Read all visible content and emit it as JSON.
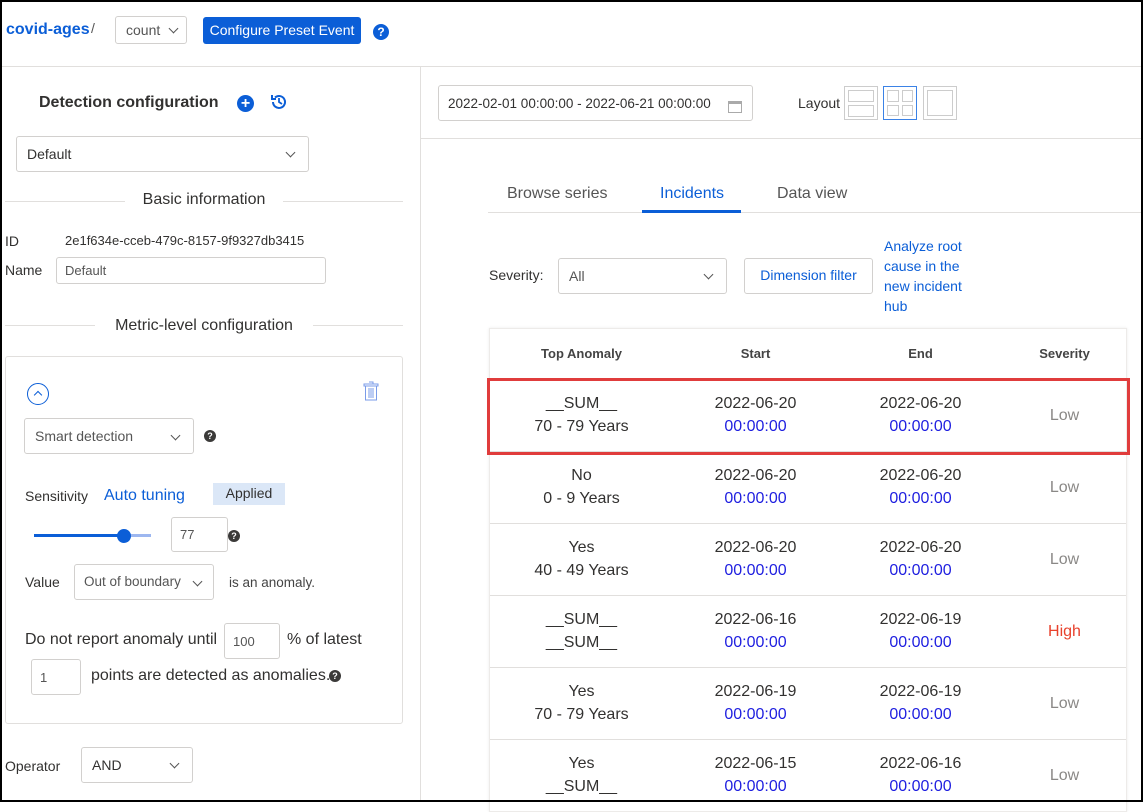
{
  "header": {
    "metric": "covid-ages",
    "separator": "/",
    "measure": "count",
    "configure_btn": "Configure Preset Event"
  },
  "left": {
    "title": "Detection configuration",
    "config_select": "Default",
    "basic_info": "Basic information",
    "id_label": "ID",
    "id_value": "2e1f634e-cceb-479c-8157-9f9327db3415",
    "name_label": "Name",
    "name_value": "Default",
    "metric_level": "Metric-level configuration",
    "method": "Smart detection",
    "sensitivity_label": "Sensitivity",
    "auto_tuning": "Auto tuning",
    "applied": "Applied",
    "sensitivity_value": "77",
    "sensitivity_fraction": 0.77,
    "value_label": "Value",
    "value_select": "Out of boundary",
    "anomaly_text": "is an anomaly.",
    "report_text1": "Do not report anomaly until",
    "report_pct": "100",
    "report_text2": "% of latest",
    "report_points": "1",
    "report_text3": "points are detected as anomalies.",
    "operator_label": "Operator",
    "operator_value": "AND"
  },
  "right": {
    "date_range": "2022-02-01 00:00:00 - 2022-06-21 00:00:00",
    "layout_label": "Layout",
    "tabs": [
      "Browse series",
      "Incidents",
      "Data view"
    ],
    "severity_label": "Severity:",
    "severity_value": "All",
    "dimension_filter": "Dimension filter",
    "analyze_link": "Analyze root cause in the new incident hub",
    "columns": [
      "Top Anomaly",
      "Start",
      "End",
      "Severity"
    ],
    "rows": [
      {
        "dim1": "__SUM__",
        "dim2": "70 - 79 Years",
        "start_date": "2022-06-20",
        "start_time": "00:00:00",
        "end_date": "2022-06-20",
        "end_time": "00:00:00",
        "severity": "Low"
      },
      {
        "dim1": "No",
        "dim2": "0 - 9 Years",
        "start_date": "2022-06-20",
        "start_time": "00:00:00",
        "end_date": "2022-06-20",
        "end_time": "00:00:00",
        "severity": "Low"
      },
      {
        "dim1": "Yes",
        "dim2": "40 - 49 Years",
        "start_date": "2022-06-20",
        "start_time": "00:00:00",
        "end_date": "2022-06-20",
        "end_time": "00:00:00",
        "severity": "Low"
      },
      {
        "dim1": "__SUM__",
        "dim2": "__SUM__",
        "start_date": "2022-06-16",
        "start_time": "00:00:00",
        "end_date": "2022-06-19",
        "end_time": "00:00:00",
        "severity": "High"
      },
      {
        "dim1": "Yes",
        "dim2": "70 - 79 Years",
        "start_date": "2022-06-19",
        "start_time": "00:00:00",
        "end_date": "2022-06-19",
        "end_time": "00:00:00",
        "severity": "Low"
      },
      {
        "dim1": "Yes",
        "dim2": "__SUM__",
        "start_date": "2022-06-15",
        "start_time": "00:00:00",
        "end_date": "2022-06-16",
        "end_time": "00:00:00",
        "severity": "Low"
      }
    ]
  },
  "colors": {
    "accent": "#0b5ed7",
    "high": "#e8412c",
    "low": "#8a8886",
    "highlight": "#e03c3c"
  }
}
